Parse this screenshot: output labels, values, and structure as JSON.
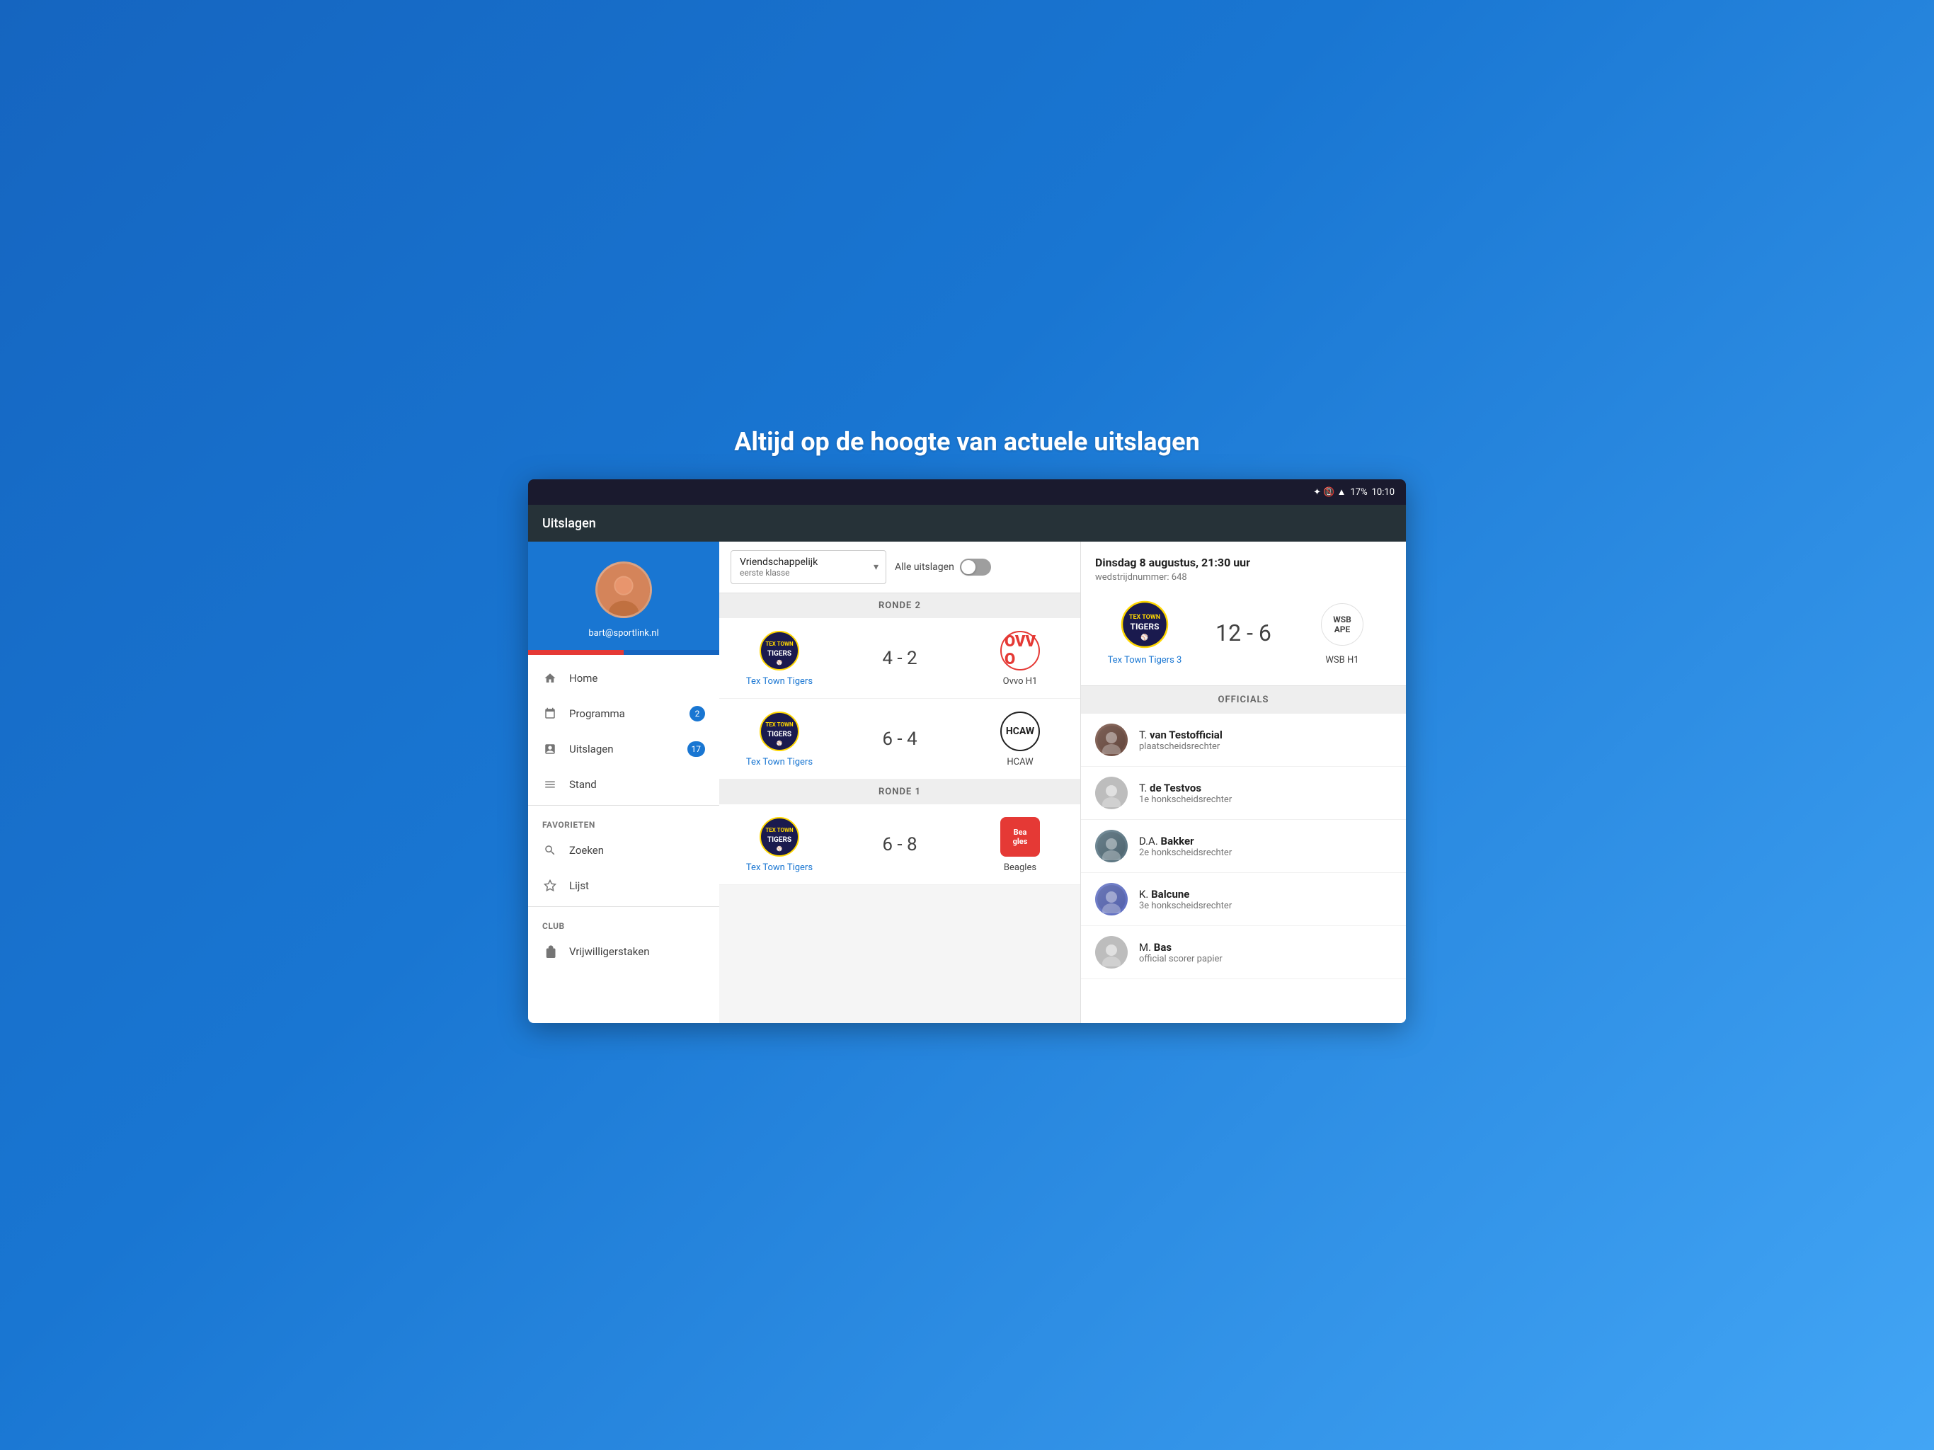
{
  "headline": "Altijd op de hoogte van actuele uitslagen",
  "statusBar": {
    "time": "10:10",
    "battery": "17%",
    "icons": "🔵 📶 🔋"
  },
  "topBar": {
    "title": "Uitslagen"
  },
  "sidebar": {
    "email": "bart@sportlink.nl",
    "navItems": [
      {
        "id": "home",
        "icon": "🏠",
        "label": "Home",
        "badge": null
      },
      {
        "id": "programma",
        "icon": "📅",
        "label": "Programma",
        "badge": "2"
      },
      {
        "id": "uitslagen",
        "icon": "📋",
        "label": "Uitslagen",
        "badge": "17"
      },
      {
        "id": "stand",
        "icon": "☰",
        "label": "Stand",
        "badge": null
      }
    ],
    "favorieten": {
      "title": "FAVORIETEN",
      "items": [
        {
          "id": "zoeken",
          "icon": "🔍",
          "label": "Zoeken"
        },
        {
          "id": "lijst",
          "icon": "☆",
          "label": "Lijst"
        }
      ]
    },
    "club": {
      "title": "CLUB",
      "items": [
        {
          "id": "vrijwilligerstaken",
          "icon": "🗂",
          "label": "Vrijwilligerstaken"
        }
      ]
    }
  },
  "resultsPanel": {
    "dropdown": {
      "mainValue": "Vriendschappelijk",
      "subValue": "eerste klasse"
    },
    "toggleLabel": "Alle uitslagen",
    "rounds": [
      {
        "label": "RONDE 2",
        "matches": [
          {
            "homeTeam": "Tex Town Tigers",
            "homeTeamType": "tigers",
            "awayTeam": "Ovvo H1",
            "awayTeamType": "ovvo",
            "score": "4 - 2"
          },
          {
            "homeTeam": "Tex Town Tigers",
            "homeTeamType": "tigers",
            "awayTeam": "HCAW",
            "awayTeamType": "hcaw",
            "score": "6 - 4"
          }
        ]
      },
      {
        "label": "RONDE 1",
        "matches": [
          {
            "homeTeam": "Tex Town Tigers",
            "homeTeamType": "tigers",
            "awayTeam": "Beagles",
            "awayTeamType": "beagles",
            "score": "6 - 8"
          }
        ]
      }
    ]
  },
  "detailPanel": {
    "date": "Dinsdag 8 augustus, 21:30 uur",
    "matchNumber": "wedstrijdnummer: 648",
    "homeTeam": "Tex Town Tigers 3",
    "homeTeamType": "tigers",
    "awayTeam": "WSB H1",
    "awayTeamType": "wsb",
    "score": "12 - 6",
    "officials": {
      "title": "OFFICIALS",
      "list": [
        {
          "initial": "T.",
          "firstName": "van Testofficial",
          "bold": "van Testofficial",
          "role": "plaatscheidsrechter",
          "avatarClass": "colored-1"
        },
        {
          "initial": "T.",
          "firstName": "de Testvos",
          "bold": "de Testvos",
          "role": "1e honkscheidsrechter",
          "avatarClass": ""
        },
        {
          "initial": "D.A.",
          "firstName": "Bakker",
          "bold": "Bakker",
          "role": "2e honkscheidsrechter",
          "avatarClass": "colored-2"
        },
        {
          "initial": "K.",
          "firstName": "Balcune",
          "bold": "Balcune",
          "role": "3e honkscheidsrechter",
          "avatarClass": "colored-3"
        },
        {
          "initial": "M.",
          "firstName": "Bas",
          "bold": "Bas",
          "role": "official scorer papier",
          "avatarClass": ""
        }
      ]
    }
  }
}
